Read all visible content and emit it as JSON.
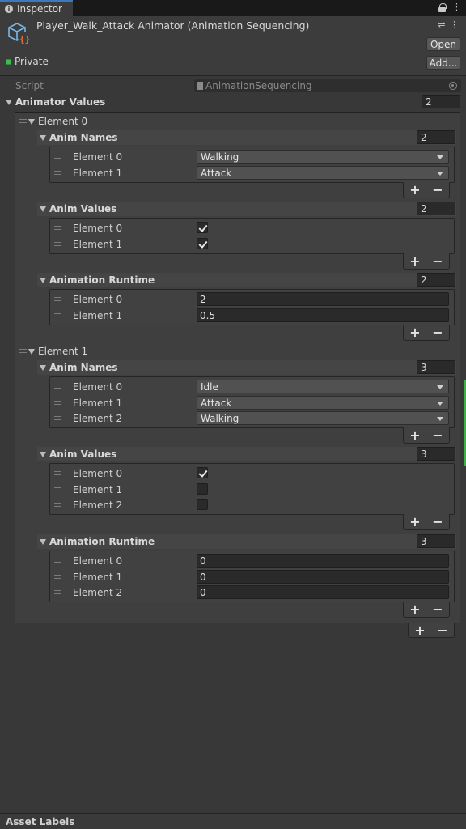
{
  "tab": {
    "title": "Inspector"
  },
  "header": {
    "title": "Player_Walk_Attack Animator (Animation Sequencing)",
    "open_label": "Open",
    "add_label": "Add...",
    "private_label": "Private"
  },
  "script": {
    "label": "Script",
    "value": "AnimationSequencing"
  },
  "animator_values": {
    "label": "Animator Values",
    "count": "2",
    "elements": [
      {
        "label": "Element 0",
        "anim_names": {
          "label": "Anim Names",
          "count": "2",
          "items": [
            {
              "label": "Element 0",
              "value": "Walking"
            },
            {
              "label": "Element 1",
              "value": "Attack"
            }
          ]
        },
        "anim_values": {
          "label": "Anim Values",
          "count": "2",
          "items": [
            {
              "label": "Element 0",
              "checked": true
            },
            {
              "label": "Element 1",
              "checked": true
            }
          ]
        },
        "animation_runtime": {
          "label": "Animation Runtime",
          "count": "2",
          "items": [
            {
              "label": "Element 0",
              "value": "2"
            },
            {
              "label": "Element 1",
              "value": "0.5"
            }
          ]
        }
      },
      {
        "label": "Element 1",
        "anim_names": {
          "label": "Anim Names",
          "count": "3",
          "items": [
            {
              "label": "Element 0",
              "value": "Idle"
            },
            {
              "label": "Element 1",
              "value": "Attack"
            },
            {
              "label": "Element 2",
              "value": "Walking"
            }
          ]
        },
        "anim_values": {
          "label": "Anim Values",
          "count": "3",
          "items": [
            {
              "label": "Element 0",
              "checked": true
            },
            {
              "label": "Element 1",
              "checked": false
            },
            {
              "label": "Element 2",
              "checked": false
            }
          ]
        },
        "animation_runtime": {
          "label": "Animation Runtime",
          "count": "3",
          "items": [
            {
              "label": "Element 0",
              "value": "0"
            },
            {
              "label": "Element 1",
              "value": "0"
            },
            {
              "label": "Element 2",
              "value": "0"
            }
          ]
        }
      }
    ]
  },
  "list_controls": {
    "add_label": "+",
    "remove_label": "−"
  },
  "footer": {
    "asset_labels": "Asset Labels"
  },
  "colors": {
    "accent": "#3a79bb",
    "private_green": "#3cbd4d",
    "background": "#383838"
  }
}
